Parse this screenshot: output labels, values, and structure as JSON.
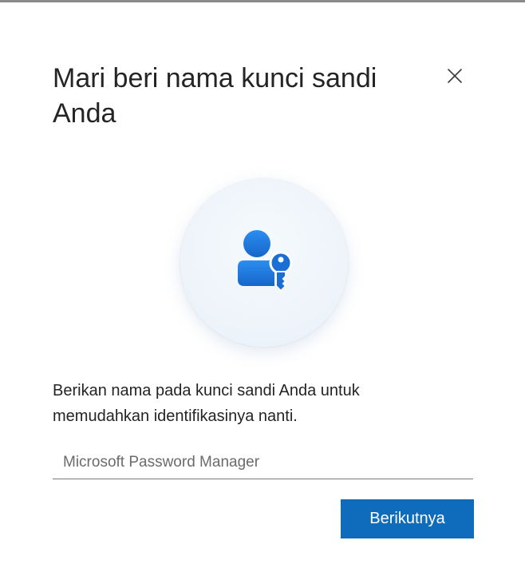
{
  "dialog": {
    "title": "Mari beri nama kunci sandi Anda",
    "close_icon": "close-icon",
    "illustration_icon": "person-key-icon",
    "description": "Berikan nama pada kunci sandi Anda untuk memudahkan identifikasinya nanti.",
    "name_input": {
      "value": "",
      "placeholder": "Microsoft Password Manager"
    },
    "next_button_label": "Berikutnya"
  },
  "colors": {
    "accent": "#0f6cbd",
    "icon_blue": "#1a73d9",
    "text": "#242424",
    "placeholder": "#6b6b6b"
  }
}
